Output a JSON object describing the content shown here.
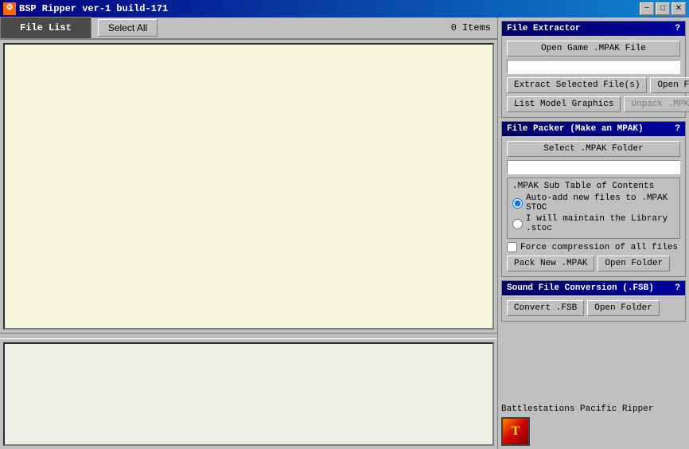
{
  "titleBar": {
    "icon": "⚙",
    "title": "BSP Ripper  ver-1 build-171",
    "buttons": {
      "minimize": "−",
      "maximize": "□",
      "close": "✕"
    }
  },
  "leftPanel": {
    "fileListTab": "File List",
    "selectAllLabel": "Select All",
    "itemsCount": "0 Items"
  },
  "fileExtractor": {
    "header": "File Extractor",
    "helpBtn": "?",
    "openGameBtn": "Open Game .MPAK File",
    "extractBtn": "Extract Selected File(s)",
    "openFolderBtn1": "Open Folder",
    "listModelBtn": "List Model Graphics",
    "unpackBtn": "Unpack .MPKG"
  },
  "filePacker": {
    "header": "File Packer (Make an MPAK)",
    "helpBtn": "?",
    "selectFolderBtn": "Select .MPAK Folder",
    "subTableTitle": ".MPAK Sub Table of Contents",
    "radio1": "Auto-add new files to .MPAK STOC",
    "radio2": "I will maintain the Library .stoc",
    "checkboxLabel": "Force compression of all files",
    "packNewBtn": "Pack New .MPAK",
    "openFolderBtn2": "Open Folder"
  },
  "soundConversion": {
    "header": "Sound File Conversion (.FSB)",
    "helpBtn": "?",
    "convertBtn": "Convert .FSB",
    "openFolderBtn3": "Open Folder"
  },
  "appInfo": {
    "appName": "Battlestations Pacific Ripper",
    "logoChar": "T"
  }
}
